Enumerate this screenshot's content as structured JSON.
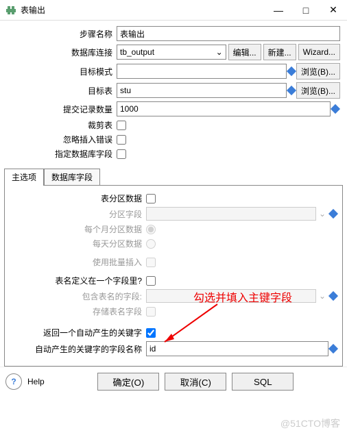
{
  "window": {
    "title": "表输出",
    "min": "—",
    "max": "□",
    "close": "✕"
  },
  "form": {
    "step_name_label": "步骤名称",
    "step_name_value": "表输出",
    "db_conn_label": "数据库连接",
    "db_conn_value": "tb_output",
    "edit_btn": "编辑...",
    "new_btn": "新建...",
    "wizard_btn": "Wizard...",
    "target_schema_label": "目标模式",
    "target_schema_value": "",
    "browse_btn": "浏览(B)...",
    "target_table_label": "目标表",
    "target_table_value": "stu",
    "commit_size_label": "提交记录数量",
    "commit_size_value": "1000",
    "truncate_label": "裁剪表",
    "ignore_err_label": "忽略插入错误",
    "specify_fields_label": "指定数据库字段"
  },
  "tabs": {
    "main": "主选项",
    "fields": "数据库字段"
  },
  "main_tab": {
    "partition_data_label": "表分区数据",
    "partition_field_label": "分区字段",
    "month_partition_label": "每个月分区数据",
    "day_partition_label": "每天分区数据",
    "batch_insert_label": "使用批量插入",
    "tablename_in_field_label": "表名定义在一个字段里?",
    "tablename_field_label": "包含表名的字段:",
    "store_tablename_label": "存储表名字段",
    "return_keys_label": "返回一个自动产生的关键字",
    "key_field_name_label": "自动产生的关键字的字段名称",
    "key_field_name_value": "id"
  },
  "annotation": "勾选并填入主键字段",
  "bottom": {
    "help": "Help",
    "ok": "确定(O)",
    "cancel": "取消(C)",
    "sql": "SQL"
  },
  "watermark": "@51CTO博客",
  "chevron": "⌄"
}
